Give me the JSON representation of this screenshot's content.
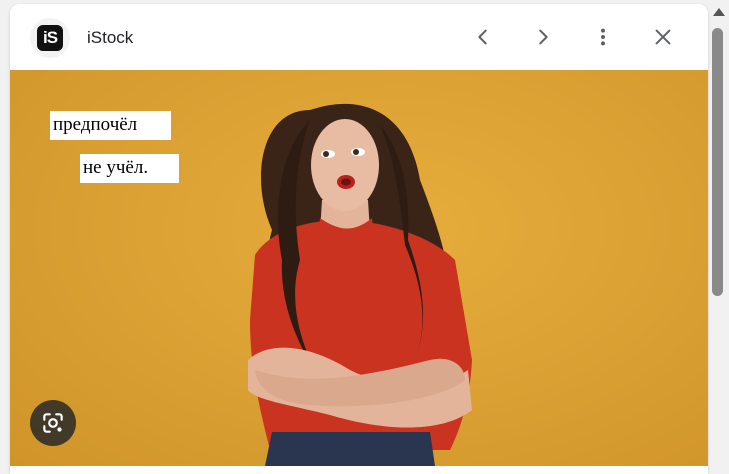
{
  "header": {
    "logo_text": "iS",
    "source_name": "iStock",
    "icons": [
      "chevron-left-icon",
      "chevron-right-icon",
      "more-vert-icon",
      "close-icon"
    ]
  },
  "image": {
    "background_color": "#dca234",
    "captions": [
      "предпочёл",
      "не учёл."
    ]
  },
  "lens": {
    "icon": "lens-search-icon"
  },
  "colors": {
    "accent_text": "#202124",
    "icon": "#5f6368"
  }
}
